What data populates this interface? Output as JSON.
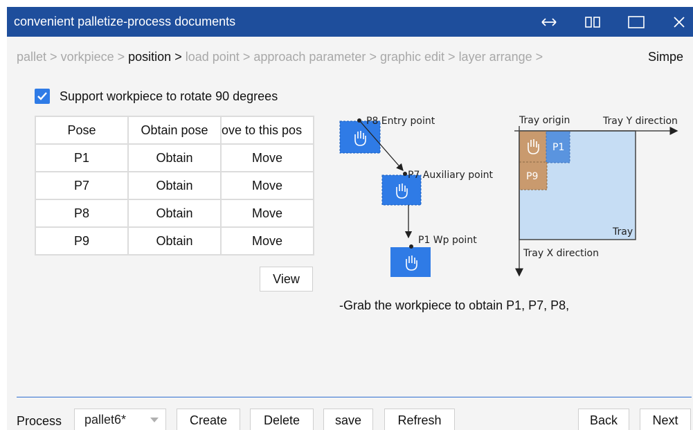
{
  "window": {
    "title": "convenient palletize-process documents",
    "controls": [
      "swap-icon",
      "split-view-icon",
      "maximize-icon",
      "close-icon"
    ],
    "accent": "#1e4e9c"
  },
  "breadcrumb": {
    "items": [
      {
        "label": "pallet",
        "state": "done"
      },
      {
        "label": "vorkpiece",
        "state": "done"
      },
      {
        "label": "position",
        "state": "current"
      },
      {
        "label": "load point",
        "state": "todo"
      },
      {
        "label": "approach parameter",
        "state": "todo"
      },
      {
        "label": "graphic edit",
        "state": "todo"
      },
      {
        "label": "layer arrange",
        "state": "todo"
      }
    ],
    "right_label": "Simpe"
  },
  "support_rotate": {
    "label": "Support workpiece to rotate 90 degrees",
    "checked": true
  },
  "pose_table": {
    "headers": [
      "Pose",
      "Obtain pose",
      "ove to this pos"
    ],
    "rows": [
      {
        "pose": "P1",
        "obtain": "Obtain",
        "move": "Move"
      },
      {
        "pose": "P7",
        "obtain": "Obtain",
        "move": "Move"
      },
      {
        "pose": "P8",
        "obtain": "Obtain",
        "move": "Move"
      },
      {
        "pose": "P9",
        "obtain": "Obtain",
        "move": "Move"
      }
    ]
  },
  "view_button": "View",
  "diagram": {
    "entry_point": "P8 Entry point",
    "auxiliary_point": "P7 Auxiliary point",
    "wp_point": "P1 Wp point",
    "tray_origin": "Tray origin",
    "tray_y": "Tray Y direction",
    "tray_x": "Tray X direction",
    "tray": "Tray",
    "p1": "P1",
    "p9": "P9",
    "colors": {
      "hand_box": "#2f7be6",
      "tray_fill": "#c6ddf4",
      "p9_fill": "#c99a6e",
      "p1_fill": "#5a94df"
    }
  },
  "description": "-Grab the workpiece to obtain P1, P7, P8,",
  "bottom": {
    "process_label": "Process",
    "process_value": "pallet6*",
    "create": "Create",
    "delete": "Delete",
    "save": "save",
    "refresh": "Refresh",
    "back": "Back",
    "next": "Next"
  }
}
